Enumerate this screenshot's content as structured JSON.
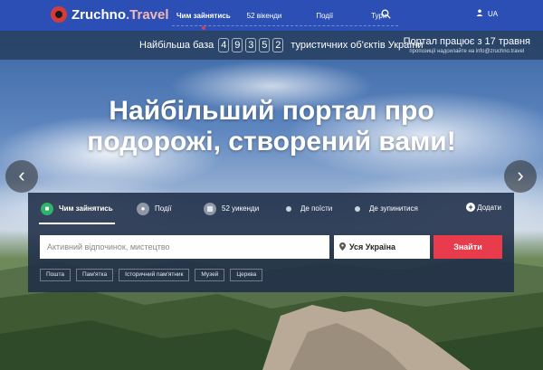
{
  "header": {
    "logo_main": "Zruchno",
    "logo_accent": ".Travel",
    "nav": [
      {
        "label": "Чим зайнятись"
      },
      {
        "label": "52 вікенди"
      },
      {
        "label": "Події"
      },
      {
        "label": "Тури"
      }
    ],
    "lang": "UA"
  },
  "stats": {
    "prefix": "Найбільша база",
    "digits": [
      "4",
      "9",
      "3",
      "5",
      "2"
    ],
    "suffix": "туристичних об'єктів України",
    "portal_line1": "Портал працює з 17 травня",
    "portal_line2": "пропозиції надсилайте на info@zruchno.travel"
  },
  "hero": {
    "headline": "Найбільший портал про подорожі, створений вами!",
    "prev": "‹",
    "next": "›"
  },
  "search": {
    "tabs": [
      {
        "label": "Чим зайнятись"
      },
      {
        "label": "Події"
      },
      {
        "label": "52 уикенди"
      },
      {
        "label": "Де поїсти"
      },
      {
        "label": "Де зупинитися"
      }
    ],
    "add_label": "Додати",
    "query_placeholder": "Активний відпочинок, мистецтво",
    "location": "Уся Україна",
    "submit": "Знайти",
    "chips": [
      "Пошта",
      "Пам'ятка",
      "Історичний пам'ятник",
      "Музей",
      "Церква"
    ]
  },
  "colors": {
    "topbar": "#2b4fb4",
    "accent_red": "#e83b4b",
    "panel": "#1f2e48"
  }
}
